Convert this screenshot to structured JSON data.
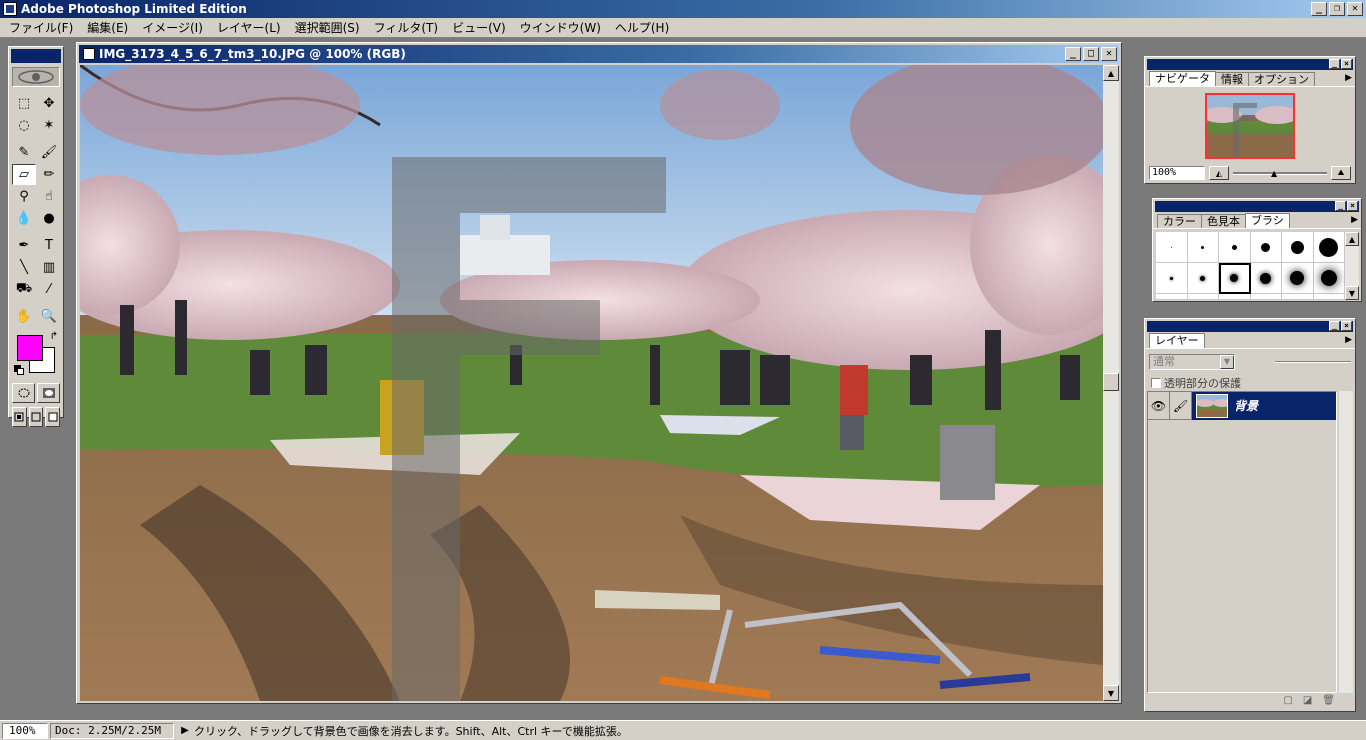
{
  "app": {
    "title": "Adobe Photoshop Limited Edition",
    "window_buttons": [
      "_",
      "❐",
      "✕"
    ]
  },
  "menubar": {
    "items": [
      "ファイル(F)",
      "編集(E)",
      "イメージ(I)",
      "レイヤー(L)",
      "選択範囲(S)",
      "フィルタ(T)",
      "ビュー(V)",
      "ウインドウ(W)",
      "ヘルプ(H)"
    ]
  },
  "document": {
    "title": "IMG_3173_4_5_6_7_tm3_10.JPG @ 100% (RGB)",
    "window_buttons": [
      "_",
      "□",
      "✕"
    ]
  },
  "toolbox": {
    "foreground_color": "#ff00ff",
    "background_color": "#ffffff",
    "tools": [
      {
        "name": "marquee-tool-icon",
        "glyph": "⬚"
      },
      {
        "name": "move-tool-icon",
        "glyph": "✥"
      },
      {
        "name": "lasso-tool-icon",
        "glyph": "◌"
      },
      {
        "name": "magic-wand-tool-icon",
        "glyph": "✶"
      },
      {
        "name": "airbrush-tool-icon",
        "glyph": "✎"
      },
      {
        "name": "paintbrush-tool-icon",
        "glyph": "🖌"
      },
      {
        "name": "eraser-tool-icon",
        "glyph": "▱",
        "active": true
      },
      {
        "name": "pencil-tool-icon",
        "glyph": "✏"
      },
      {
        "name": "rubber-stamp-tool-icon",
        "glyph": "⚲"
      },
      {
        "name": "smudge-tool-icon",
        "glyph": "☝"
      },
      {
        "name": "blur-tool-icon",
        "glyph": "💧"
      },
      {
        "name": "dodge-tool-icon",
        "glyph": "●"
      },
      {
        "name": "pen-tool-icon",
        "glyph": "✒"
      },
      {
        "name": "type-tool-icon",
        "glyph": "T"
      },
      {
        "name": "line-tool-icon",
        "glyph": "╲"
      },
      {
        "name": "gradient-tool-icon",
        "glyph": "▥"
      },
      {
        "name": "paint-bucket-tool-icon",
        "glyph": "⛟"
      },
      {
        "name": "eyedropper-tool-icon",
        "glyph": "⁄"
      },
      {
        "name": "hand-tool-icon",
        "glyph": "✋"
      },
      {
        "name": "zoom-tool-icon",
        "glyph": "🔍"
      }
    ]
  },
  "navigator": {
    "tabs": [
      "ナビゲータ",
      "情報",
      "オプション"
    ],
    "active_tab": 0,
    "zoom_value": "100%"
  },
  "brushes": {
    "tabs": [
      "カラー",
      "色見本",
      "ブラシ"
    ],
    "active_tab": 2
  },
  "layers": {
    "tab": "レイヤー",
    "blend_mode": "通常",
    "preserve_transparency_label": "透明部分の保護",
    "items": [
      {
        "name": "背景",
        "visible": true,
        "selected": true
      }
    ]
  },
  "statusbar": {
    "zoom": "100%",
    "doc_info": "Doc: 2.25M/2.25M",
    "hint": "クリック、ドラッグして背景色で画像を消去します。Shift、Alt、Ctrl キーで機能拡張。"
  }
}
